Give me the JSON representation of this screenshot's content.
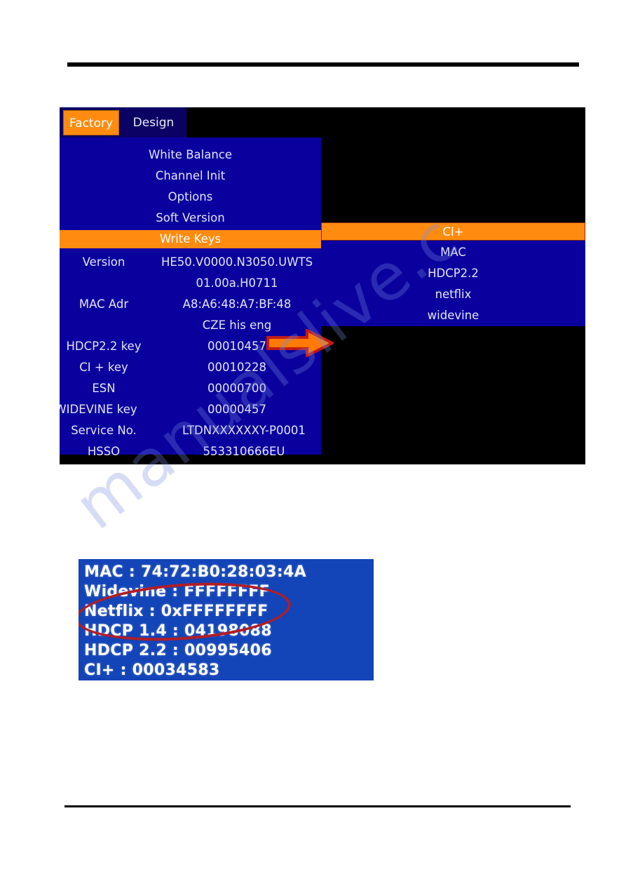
{
  "page": {
    "background": "#ffffff",
    "watermark_text": "manualslive.c"
  },
  "figure_tv_menu": {
    "tabs": [
      {
        "label": "Factory",
        "state": "selected"
      },
      {
        "label": "Design",
        "state": "normal"
      }
    ],
    "menu_items": [
      {
        "label": "White Balance",
        "state": "normal"
      },
      {
        "label": "Channel Init",
        "state": "normal"
      },
      {
        "label": "Options",
        "state": "normal"
      },
      {
        "label": "Soft Version",
        "state": "normal"
      },
      {
        "label": "Write Keys",
        "state": "selected"
      }
    ],
    "details": [
      {
        "label": "Version",
        "value": "HE50.V0000.N3050.UWTS"
      },
      {
        "label": "",
        "value": "01.00a.H0711"
      },
      {
        "label": "MAC Adr",
        "value": "A8:A6:48:A7:BF:48"
      },
      {
        "label": "",
        "value": "CZE his eng"
      },
      {
        "label": "HDCP2.2 key",
        "value": "00010457"
      },
      {
        "label": "CI + key",
        "value": "00010228"
      },
      {
        "label": "ESN",
        "value": "00000700"
      },
      {
        "label": "WIDEVINE key",
        "value": "00000457"
      },
      {
        "label": "Service No.",
        "value": "LTDNXXXXXXY-P0001"
      },
      {
        "label": "HSSO",
        "value": "553310666EU"
      }
    ],
    "submenu_items": [
      {
        "label": "CI+",
        "state": "selected"
      },
      {
        "label": "MAC",
        "state": "normal"
      },
      {
        "label": "HDCP2.2",
        "state": "normal"
      },
      {
        "label": "netflix",
        "state": "normal"
      },
      {
        "label": "widevine",
        "state": "normal"
      }
    ],
    "annotation": {
      "type": "right-arrow",
      "fill": "#ff7a00",
      "outline": "#c01a18"
    },
    "colors": {
      "menu_blue": "#0a009e",
      "tab_bar_navy": "#0b0064",
      "highlight_orange": "#ff8c10",
      "screen_black": "#000000",
      "text": "#e4e4f6"
    }
  },
  "figure_key_readout": {
    "lines": [
      "MAC : 74:72:B0:28:03:4A",
      "Widevine : FFFFFFFF",
      "Netflix : 0xFFFFFFFF",
      "HDCP 1.4 : 04198088",
      "HDCP 2.2 : 00995406",
      "CI+ : 00034583"
    ],
    "annotation": {
      "type": "ellipse",
      "color": "#b01e28"
    },
    "colors": {
      "background": "#1344b8",
      "text": "#ffffff"
    }
  }
}
